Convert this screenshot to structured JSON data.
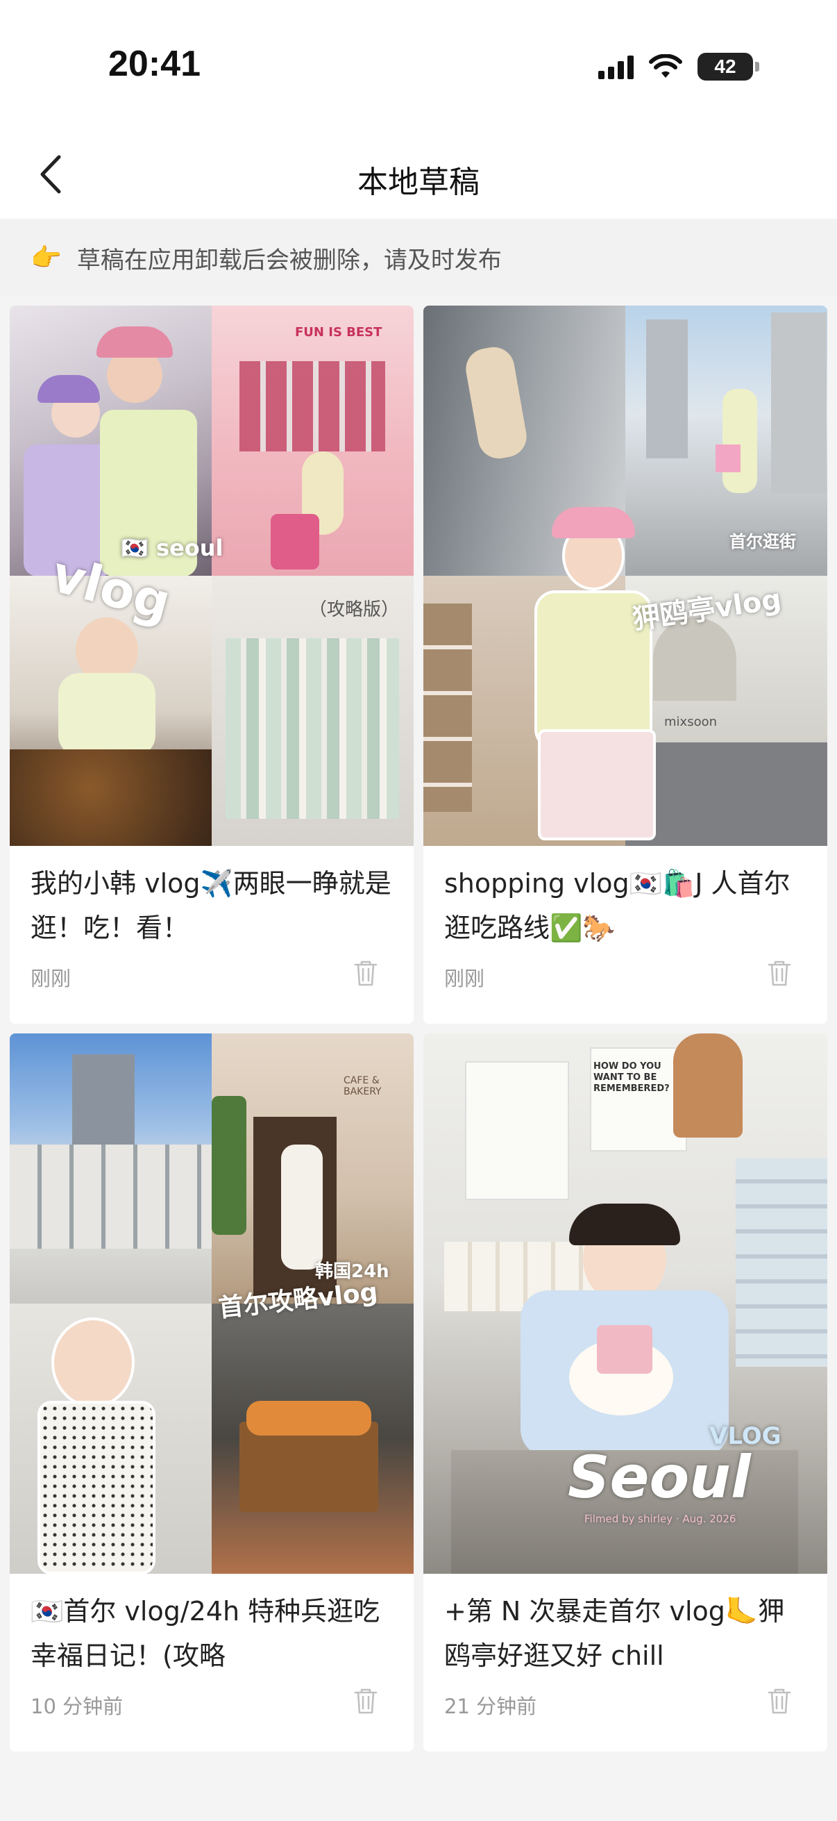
{
  "status_bar": {
    "time": "20:41",
    "battery": "42"
  },
  "nav": {
    "title": "本地草稿"
  },
  "notice": {
    "icon": "👉",
    "text": "草稿在应用卸载后会被删除，请及时发布"
  },
  "drafts": [
    {
      "title": "我的小韩 vlog✈️两眼一睁就是逛！吃！看！",
      "time": "刚刚",
      "overlay": {
        "main": "vlog",
        "sub": "🇰🇷 seoul",
        "tag": "（攻略版）",
        "sign": "FUN IS BEST"
      }
    },
    {
      "title": "shopping vlog🇰🇷🛍️J 人首尔逛吃路线✅🐎",
      "time": "刚刚",
      "overlay": {
        "main": "狎鸥亭vlog",
        "sub": "首尔逛街",
        "shop": "mixsoon"
      }
    },
    {
      "title": "🇰🇷首尔 vlog/24h 特种兵逛吃幸福日记！(攻略",
      "time": "10 分钟前",
      "overlay": {
        "main": "首尔攻略vlog",
        "sub": "韩国24h",
        "cafe": "CAFE & BAKERY"
      }
    },
    {
      "title": "+第 N 次暴走首尔 vlog🦶狎鸥亭好逛又好 chill",
      "time": "21 分钟前",
      "overlay": {
        "main": "Seoul",
        "sub": "VLOG",
        "credit": "Filmed by shirley · Aug. 2026",
        "poster": "HOW DO YOU WANT TO BE REMEMBERED?"
      }
    }
  ],
  "icons": {
    "back": "chevron-left-icon",
    "delete": "trash-icon",
    "wifi": "wifi-icon",
    "signal": "signal-icon"
  },
  "colors": {
    "background": "#f4f4f4",
    "card": "#ffffff",
    "muted": "#999999"
  }
}
